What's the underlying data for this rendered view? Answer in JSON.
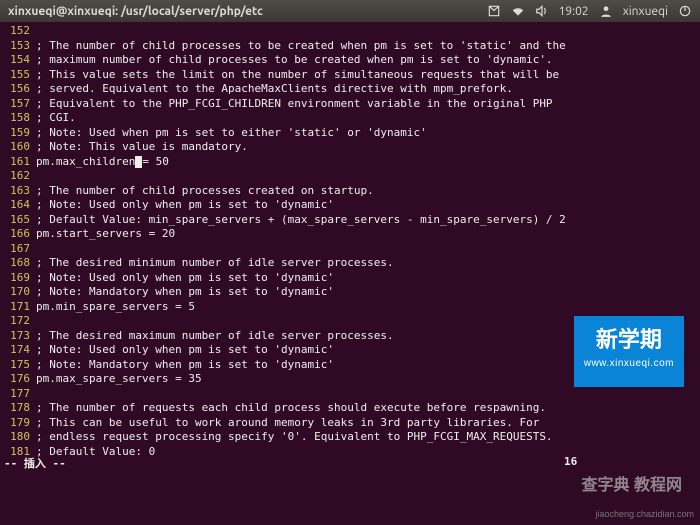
{
  "menubar": {
    "title": "xinxueqi@xinxueqi: /usr/local/server/php/etc",
    "time": "19:02",
    "user": "xinxueqi"
  },
  "lines": [
    {
      "n": "152",
      "t": ""
    },
    {
      "n": "153",
      "t": "; The number of child processes to be created when pm is set to 'static' and the"
    },
    {
      "n": "154",
      "t": "; maximum number of child processes to be created when pm is set to 'dynamic'."
    },
    {
      "n": "155",
      "t": "; This value sets the limit on the number of simultaneous requests that will be"
    },
    {
      "n": "156",
      "t": "; served. Equivalent to the ApacheMaxClients directive with mpm_prefork."
    },
    {
      "n": "157",
      "t": "; Equivalent to the PHP_FCGI_CHILDREN environment variable in the original PHP"
    },
    {
      "n": "158",
      "t": "; CGI."
    },
    {
      "n": "159",
      "t": "; Note: Used when pm is set to either 'static' or 'dynamic'"
    },
    {
      "n": "160",
      "t": "; Note: This value is mandatory."
    },
    {
      "n": "161",
      "t": "pm.max_children",
      "cursor": true,
      "after": "= 50"
    },
    {
      "n": "162",
      "t": ""
    },
    {
      "n": "163",
      "t": "; The number of child processes created on startup."
    },
    {
      "n": "164",
      "t": "; Note: Used only when pm is set to 'dynamic'"
    },
    {
      "n": "165",
      "t": "; Default Value: min_spare_servers + (max_spare_servers - min_spare_servers) / 2"
    },
    {
      "n": "166",
      "t": "pm.start_servers = 20"
    },
    {
      "n": "167",
      "t": ""
    },
    {
      "n": "168",
      "t": "; The desired minimum number of idle server processes."
    },
    {
      "n": "169",
      "t": "; Note: Used only when pm is set to 'dynamic'"
    },
    {
      "n": "170",
      "t": "; Note: Mandatory when pm is set to 'dynamic'"
    },
    {
      "n": "171",
      "t": "pm.min_spare_servers = 5"
    },
    {
      "n": "172",
      "t": ""
    },
    {
      "n": "173",
      "t": "; The desired maximum number of idle server processes."
    },
    {
      "n": "174",
      "t": "; Note: Used only when pm is set to 'dynamic'"
    },
    {
      "n": "175",
      "t": "; Note: Mandatory when pm is set to 'dynamic'"
    },
    {
      "n": "176",
      "t": "pm.max_spare_servers = 35"
    },
    {
      "n": "177",
      "t": ""
    },
    {
      "n": "178",
      "t": "; The number of requests each child process should execute before respawning."
    },
    {
      "n": "179",
      "t": "; This can be useful to work around memory leaks in 3rd party libraries. For"
    },
    {
      "n": "180",
      "t": "; endless request processing specify '0'. Equivalent to PHP_FCGI_MAX_REQUESTS."
    },
    {
      "n": "181",
      "t": "; Default Value: 0"
    }
  ],
  "status": {
    "mode": "-- 插入 --",
    "pos": "16"
  },
  "badge": {
    "text": "新学期",
    "url": "www.xinxueqi.com"
  },
  "watermark1": "查字典 教程网",
  "watermark2": "jiaocheng.chazidian.com"
}
